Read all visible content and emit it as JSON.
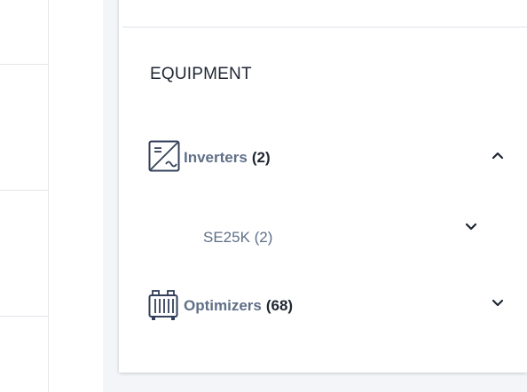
{
  "equipment": {
    "title": "EQUIPMENT",
    "inverters": {
      "label": "Inverters",
      "count": "(2)",
      "icon": "inverter-icon",
      "expanded": true,
      "children": [
        {
          "label": "SE25K (2)"
        }
      ]
    },
    "optimizers": {
      "label": "Optimizers",
      "count": "(68)",
      "icon": "optimizer-icon",
      "expanded": false
    }
  },
  "colors": {
    "label": "#5f6f87",
    "count": "#1f2733",
    "background": "#f3f5f8",
    "icon": "#34405a"
  }
}
